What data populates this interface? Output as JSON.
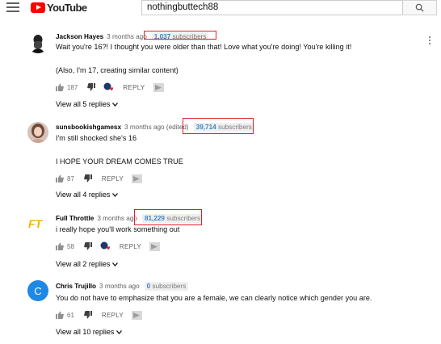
{
  "header": {
    "logo_text": "YouTube",
    "search_value": "nothingbuttech88"
  },
  "comments": [
    {
      "author": "Jackson Hayes",
      "time": "3 months ago",
      "subs_count": "1,037",
      "subs_label": "subscribers",
      "text_lines": [
        "Wait you're 16?! I thought you were older than that! Love what you're doing! You're killing it!",
        "(Also, I'm 17, creating similar content)"
      ],
      "likes": "187",
      "reply_label": "REPLY",
      "view_replies": "View all 5 replies"
    },
    {
      "author": "sunsbookishgamesx",
      "time": "3 months ago (edited)",
      "subs_count": "39,714",
      "subs_label": "subscribers",
      "text_lines": [
        "I'm still shocked she's 16",
        "I HOPE YOUR DREAM COMES TRUE"
      ],
      "likes": "87",
      "reply_label": "REPLY",
      "view_replies": "View all 4 replies"
    },
    {
      "author": "Full Throttle",
      "time": "3 months ago",
      "subs_count": "81,229",
      "subs_label": "subscribers",
      "text_lines": [
        "i really hope you'll work something out"
      ],
      "likes": "58",
      "reply_label": "REPLY",
      "view_replies": "View all 2 replies",
      "avatar_text": "FT"
    },
    {
      "author": "Chris Trujillo",
      "time": "3 months ago",
      "subs_count": "0",
      "subs_label": "subscribers",
      "text_lines": [
        "You do not have to emphasize that you are a female, we can clearly notice which gender you are."
      ],
      "likes": "61",
      "reply_label": "REPLY",
      "view_replies": "View all 10 replies",
      "avatar_text": "C"
    }
  ],
  "colors": {
    "brand_red": "#ff0000",
    "highlight_box": "#e0202a",
    "subscriber_count": "#3b83c6"
  }
}
